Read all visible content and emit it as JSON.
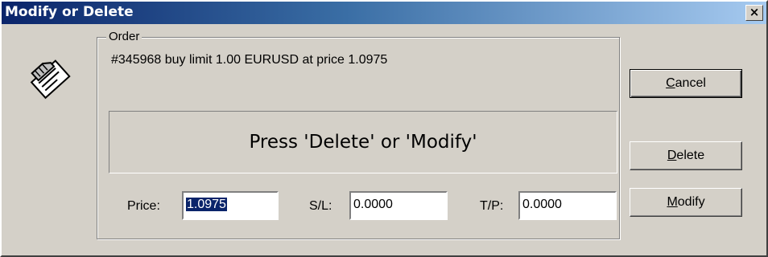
{
  "window": {
    "title": "Modify or Delete",
    "close_label": "×"
  },
  "order": {
    "group_label": "Order",
    "info": "#345968  buy limit 1.00 EURUSD at price 1.0975"
  },
  "message": "Press 'Delete' or 'Modify'",
  "fields": {
    "price": {
      "label": "Price:",
      "value": "1.0975"
    },
    "sl": {
      "label": "S/L:",
      "value": "0.0000"
    },
    "tp": {
      "label": "T/P:",
      "value": "0.0000"
    }
  },
  "buttons": {
    "cancel": {
      "accel": "C",
      "rest": "ancel"
    },
    "delete": {
      "accel": "D",
      "rest": "elete"
    },
    "modify": {
      "accel": "M",
      "rest": "odify"
    }
  },
  "icons": {
    "dialog_icon": "hand-pointing-document-icon",
    "close_icon": "close-icon"
  },
  "colors": {
    "title_start": "#0a246a",
    "title_end": "#a6caf0",
    "face": "#d4d0c8",
    "selection": "#0a246a"
  }
}
